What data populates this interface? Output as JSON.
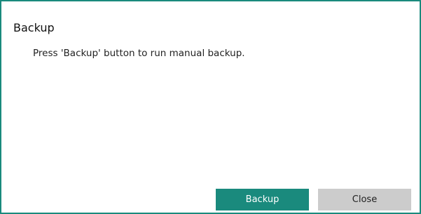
{
  "dialog": {
    "title": "Backup",
    "message": "Press 'Backup' button to run manual backup.",
    "backup_label": "Backup",
    "close_label": "Close"
  },
  "colors": {
    "accent": "#1a8a7d",
    "secondary_button": "#cccccc"
  }
}
